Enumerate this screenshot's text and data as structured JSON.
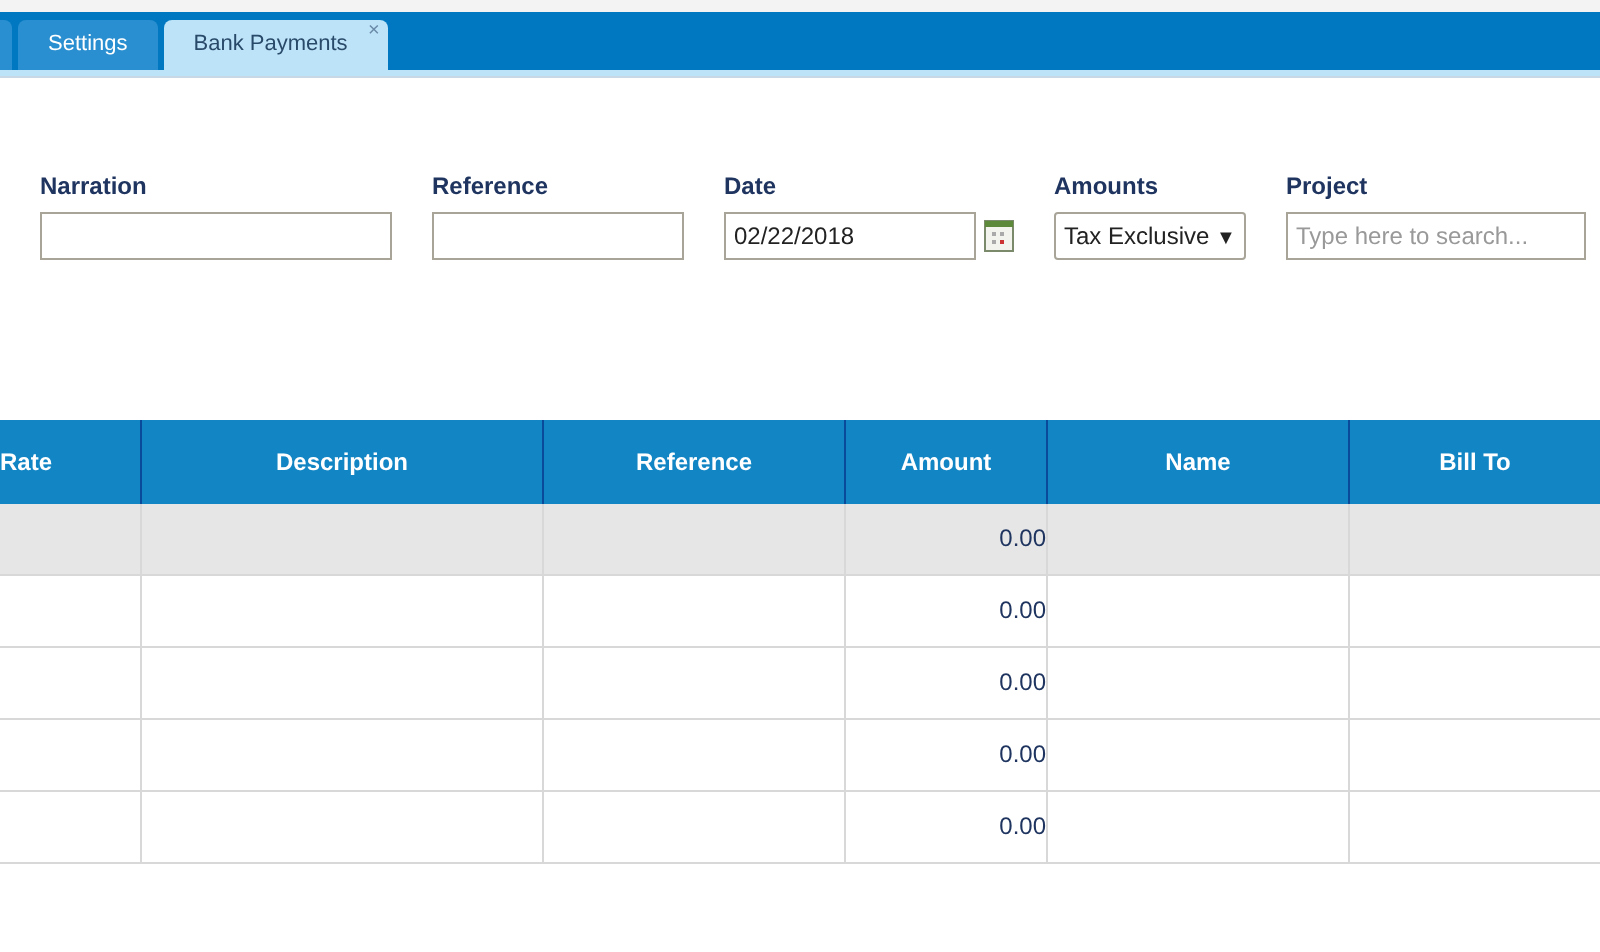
{
  "tabs": [
    {
      "label": "Settings",
      "selected": false
    },
    {
      "label": "Bank Payments",
      "selected": true,
      "close_glyph": "×"
    }
  ],
  "form": {
    "fields": [
      {
        "kind": "text",
        "label": "Narration"
      },
      {
        "kind": "text",
        "label": "Reference"
      },
      {
        "kind": "date",
        "label": "Date",
        "value": "02/22/2018"
      },
      {
        "kind": "select",
        "label": "Amounts",
        "value": "Tax Exclusive",
        "caret": "▼"
      },
      {
        "kind": "search",
        "label": "Project",
        "placeholder": "Type here to search..."
      }
    ]
  },
  "table": {
    "columns": [
      "Rate",
      "Description",
      "Reference",
      "Amount",
      "Name",
      "Bill To"
    ],
    "rows": [
      {
        "selected": true,
        "amount": "0.00"
      },
      {
        "selected": false,
        "amount": "0.00"
      },
      {
        "selected": false,
        "amount": "0.00"
      },
      {
        "selected": false,
        "amount": "0.00"
      },
      {
        "selected": false,
        "amount": "0.00"
      }
    ]
  }
}
